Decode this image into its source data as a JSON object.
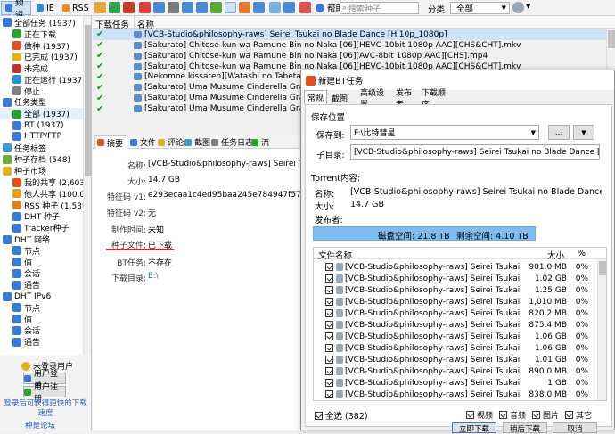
{
  "toolbar": {
    "tabs": [
      "频道",
      "IE",
      "RSS"
    ],
    "help": "帮助",
    "search_placeholder": "搜索种子",
    "category_label": "分类",
    "category_value": "全部"
  },
  "sidebar": {
    "items": [
      {
        "label": "全部任务 (1937)",
        "level": 0,
        "color": "#3a7bd5"
      },
      {
        "label": "正在下载",
        "level": 1,
        "color": "#2aa12a"
      },
      {
        "label": "做种 (1937)",
        "level": 1,
        "color": "#e05020"
      },
      {
        "label": "已完成 (1937)",
        "level": 1,
        "color": "#e0b020"
      },
      {
        "label": "未完成",
        "level": 1,
        "color": "#c03030"
      },
      {
        "label": "正在运行 (1937)",
        "level": 1,
        "color": "#2a8fd5"
      },
      {
        "label": "停止",
        "level": 1,
        "color": "#808080"
      },
      {
        "label": "任务类型",
        "level": 0,
        "color": "#3a7bd5"
      },
      {
        "label": "全部 (1937)",
        "level": 1,
        "color": "#2aa12a"
      },
      {
        "label": "BT (1937)",
        "level": 1,
        "color": "#3a7bd5"
      },
      {
        "label": "HTTP/FTP",
        "level": 1,
        "color": "#3a7bd5"
      },
      {
        "label": "任务标签",
        "level": 0,
        "color": "#3a9bd5"
      },
      {
        "label": "种子存档 (548)",
        "level": 0,
        "color": "#6aaf30"
      },
      {
        "label": "种子市场",
        "level": 0,
        "color": "#e0b020"
      },
      {
        "label": "我的共享 (2,603)",
        "level": 1,
        "color": "#e05020"
      },
      {
        "label": "他人共享 (100,00",
        "level": 1,
        "color": "#e0a020"
      },
      {
        "label": "RSS 种子 (1,539)",
        "level": 1,
        "color": "#e08020"
      },
      {
        "label": "DHT 种子",
        "level": 1,
        "color": "#3a7bd5"
      },
      {
        "label": "Tracker种子",
        "level": 1,
        "color": "#3a7bd5"
      },
      {
        "label": "DHT 网络",
        "level": 0,
        "color": "#3a7bd5"
      },
      {
        "label": "节点",
        "level": 1,
        "color": "#3a7bd5"
      },
      {
        "label": "值",
        "level": 1,
        "color": "#3a7bd5"
      },
      {
        "label": "会话",
        "level": 1,
        "color": "#3a7bd5"
      },
      {
        "label": "通告",
        "level": 1,
        "color": "#3a7bd5"
      },
      {
        "label": "DHT IPv6",
        "level": 0,
        "color": "#3a7bd5"
      },
      {
        "label": "节点",
        "level": 1,
        "color": "#3a7bd5"
      },
      {
        "label": "值",
        "level": 1,
        "color": "#3a7bd5"
      },
      {
        "label": "会话",
        "level": 1,
        "color": "#3a7bd5"
      },
      {
        "label": "通告",
        "level": 1,
        "color": "#3a7bd5"
      }
    ]
  },
  "userpanel": {
    "not_logged": "未登录用户",
    "login": "用户登录",
    "register": "用户注册",
    "promo": "登录后可获得更快的下载速度",
    "forum": "种是论坛"
  },
  "list": {
    "headers": [
      "下载任务",
      "名称"
    ],
    "rows": [
      {
        "name": "[VCB-Studio&philosophy-raws] Seirei Tsukai no Blade Dance [Hi10p_1080p]",
        "selected": true
      },
      {
        "name": "[Sakurato] Chitose-kun wa Ramune Bin no Naka [06][HEVC-10bit 1080p AAC][CHS&CHT].mkv",
        "selected": false
      },
      {
        "name": "[Sakurato] Chitose-kun wa Ramune Bin no Naka [06][AVC-8bit 1080p AAC][CHS].mp4",
        "selected": false
      },
      {
        "name": "[Sakurato] Chitose-kun wa Ramune Bin no Naka [06][HEVC-10bit 1080p AAC][CHS&CHT].mkv",
        "selected": false
      },
      {
        "name": "[Nekomoe kissaten][Watashi no Tabetai, Hito",
        "selected": false
      },
      {
        "name": "[Sakurato] Uma Musume Cinderella Gray [20][",
        "selected": false
      },
      {
        "name": "[Sakurato] Uma Musume Cinderella Gray [20][",
        "selected": false
      },
      {
        "name": "[Sakurato] Uma Musume Cinderella Gray [20][",
        "selected": false
      }
    ]
  },
  "detail": {
    "tabs": [
      "摘要",
      "文件",
      "评论",
      "截图",
      "任务日志",
      "流"
    ],
    "fields": [
      {
        "label": "名称:",
        "value": "[VCB-Studio&philosophy-raws] Seirei Tsukai"
      },
      {
        "label": "大小:",
        "value": "14.7 GB"
      },
      {
        "label": "特征码 v1:",
        "value": "e293ecaa1c4ed95baa245e784947f57cb8811c"
      },
      {
        "label": "特征码 v2:",
        "value": "无"
      },
      {
        "label": "制作时间:",
        "value": "未知"
      },
      {
        "label": "种子文件:",
        "value": "已下载"
      },
      {
        "label": "BT任务:",
        "value": "不存在"
      },
      {
        "label": "下载目录:",
        "value": "E:\\"
      }
    ]
  },
  "dialog": {
    "title": "新建BT任务",
    "tabs": [
      "常规",
      "截图",
      "高级设置",
      "发布者",
      "下载顺序"
    ],
    "save_section": "保存位置",
    "save_to_label": "保存到:",
    "save_to_value": "F:\\比特彗星",
    "browse": "...",
    "subdir_label": "子目录:",
    "subdir_value": "[VCB-Studio&philosophy-raws] Seirei Tsukai no Blade Dance [Hi10p_108",
    "torrent_section": "Torrent内容:",
    "name_label": "名称:",
    "name_value": "[VCB-Studio&philosophy-raws] Seirei Tsukai no Blade Dance [Hi10p_108",
    "size_label": "大小:",
    "size_value": "14.7 GB",
    "publisher_label": "发布者:",
    "disk_space": "磁盘空间: 21.8 TB",
    "free_space": "剩余空间: 4.10 TB",
    "columns": [
      "文件名称",
      "大小",
      "%"
    ],
    "files": [
      {
        "name": "[VCB-Studio&philosophy-raws] Seirei Tsukai no ...",
        "size": "901.0 MB",
        "pct": "0%"
      },
      {
        "name": "[VCB-Studio&philosophy-raws] Seirei Tsukai no ...",
        "size": "1.02 GB",
        "pct": "0%"
      },
      {
        "name": "[VCB-Studio&philosophy-raws] Seirei Tsukai no ...",
        "size": "1.25 GB",
        "pct": "0%"
      },
      {
        "name": "[VCB-Studio&philosophy-raws] Seirei Tsukai no ...",
        "size": "1,010 MB",
        "pct": "0%"
      },
      {
        "name": "[VCB-Studio&philosophy-raws] Seirei Tsukai no ...",
        "size": "820.2 MB",
        "pct": "0%"
      },
      {
        "name": "[VCB-Studio&philosophy-raws] Seirei Tsukai no ...",
        "size": "875.4 MB",
        "pct": "0%"
      },
      {
        "name": "[VCB-Studio&philosophy-raws] Seirei Tsukai no ...",
        "size": "1.06 GB",
        "pct": "0%"
      },
      {
        "name": "[VCB-Studio&philosophy-raws] Seirei Tsukai no ...",
        "size": "1.06 GB",
        "pct": "0%"
      },
      {
        "name": "[VCB-Studio&philosophy-raws] Seirei Tsukai no ...",
        "size": "1.01 GB",
        "pct": "0%"
      },
      {
        "name": "[VCB-Studio&philosophy-raws] Seirei Tsukai no ...",
        "size": "890.0 MB",
        "pct": "0%"
      },
      {
        "name": "[VCB-Studio&philosophy-raws] Seirei Tsukai no ...",
        "size": "1 GB",
        "pct": "0%"
      },
      {
        "name": "[VCB-Studio&philosophy-raws] Seirei Tsukai no ...",
        "size": "838.0 MB",
        "pct": "0%"
      }
    ],
    "select_all": "全选 (382)",
    "filters": [
      "视频",
      "音频",
      "图片",
      "其它"
    ],
    "buttons": [
      "立即下载",
      "稍后下载",
      "取消"
    ]
  },
  "colors": {
    "accent": "#3a7bd5",
    "selection": "#cde3fa",
    "underline": "#e02020",
    "check": "#1a9a1a"
  }
}
